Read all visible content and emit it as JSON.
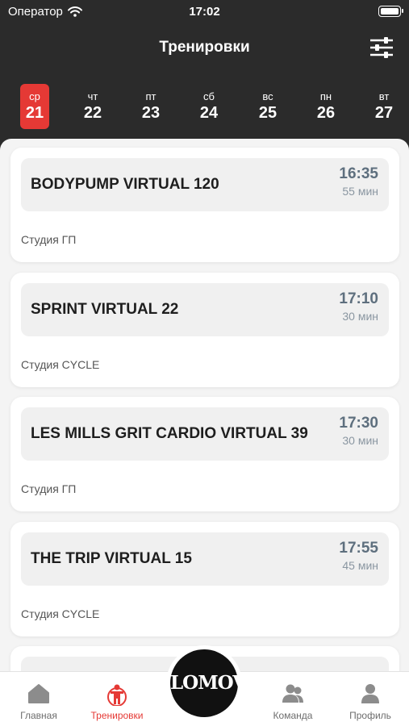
{
  "status_bar": {
    "carrier": "Оператор",
    "time": "17:02"
  },
  "header": {
    "title": "Тренировки"
  },
  "days": [
    {
      "dow": "ср",
      "num": "21",
      "active": true
    },
    {
      "dow": "чт",
      "num": "22"
    },
    {
      "dow": "пт",
      "num": "23"
    },
    {
      "dow": "сб",
      "num": "24"
    },
    {
      "dow": "вс",
      "num": "25"
    },
    {
      "dow": "пн",
      "num": "26"
    },
    {
      "dow": "вт",
      "num": "27"
    }
  ],
  "workouts": [
    {
      "name": "BODYPUMP VIRTUAL 120",
      "time": "16:35",
      "duration": "55 мин",
      "studio": "Студия ГП"
    },
    {
      "name": "SPRINT VIRTUAL 22",
      "time": "17:10",
      "duration": "30 мин",
      "studio": "Студия CYCLE"
    },
    {
      "name": "LES MILLS GRIT CARDIO VIRTUAL 39",
      "time": "17:30",
      "duration": "30 мин",
      "studio": "Студия ГП"
    },
    {
      "name": "THE TRIP VIRTUAL 15",
      "time": "17:55",
      "duration": "45 мин",
      "studio": "Студия CYCLE"
    }
  ],
  "tabs": {
    "home": "Главная",
    "workouts": "Тренировки",
    "team": "Команда",
    "profile": "Профиль"
  },
  "logo_text": "LOMOV",
  "colors": {
    "accent": "#e53935",
    "header_bg": "#2b2b2b",
    "time_text": "#5e6f7e"
  },
  "icons": [
    "wifi-icon",
    "battery-icon",
    "filter-sliders-icon",
    "home-icon",
    "workout-figure-icon",
    "team-icon",
    "profile-icon"
  ]
}
